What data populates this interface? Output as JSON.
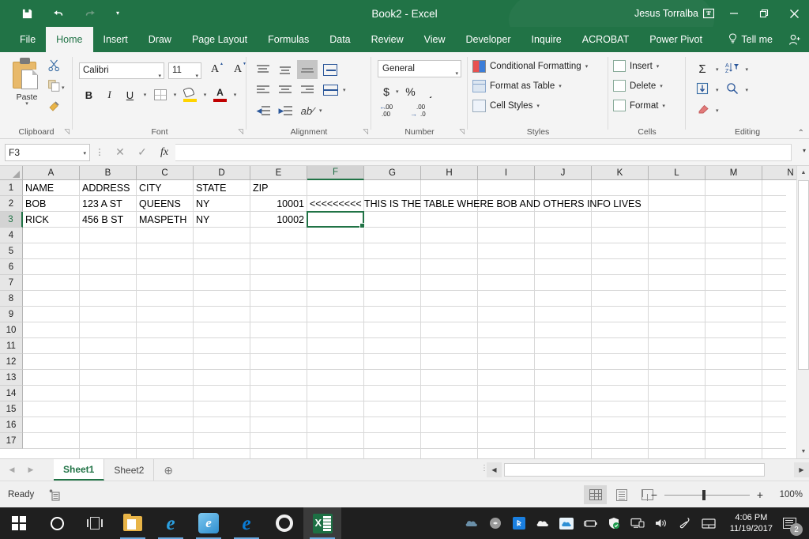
{
  "titlebar": {
    "doc_title": "Book2  -  Excel",
    "account_name": "Jesus Torralba",
    "qat": [
      {
        "name": "save",
        "glyph": "💾"
      },
      {
        "name": "undo",
        "glyph": "↶"
      },
      {
        "name": "redo",
        "glyph": "↷"
      },
      {
        "name": "customize-qat",
        "glyph": "▾"
      }
    ],
    "ribbon_display_options": "❐",
    "minimize": "─",
    "restore": "❐",
    "close": "✕"
  },
  "ribbon_tabs": [
    {
      "label": "File",
      "active": false
    },
    {
      "label": "Home",
      "active": true
    },
    {
      "label": "Insert",
      "active": false
    },
    {
      "label": "Draw",
      "active": false
    },
    {
      "label": "Page Layout",
      "active": false
    },
    {
      "label": "Formulas",
      "active": false
    },
    {
      "label": "Data",
      "active": false
    },
    {
      "label": "Review",
      "active": false
    },
    {
      "label": "View",
      "active": false
    },
    {
      "label": "Developer",
      "active": false
    },
    {
      "label": "Inquire",
      "active": false
    },
    {
      "label": "ACROBAT",
      "active": false
    },
    {
      "label": "Power Pivot",
      "active": false
    }
  ],
  "tell_me": "Tell me",
  "ribbon": {
    "clipboard": {
      "group_label": "Clipboard",
      "paste_label": "Paste",
      "cut_glyph": "✂",
      "copy_name": "copy",
      "format_painter_name": "format-painter"
    },
    "font": {
      "group_label": "Font",
      "font_name": "Calibri",
      "font_size": "11",
      "bold": "B",
      "italic": "I",
      "underline": "U",
      "grow_font": "A",
      "shrink_font": "A",
      "font_color_letter": "A"
    },
    "alignment": {
      "group_label": "Alignment",
      "wrap_text_name": "wrap-text",
      "merge_center_name": "merge-and-center"
    },
    "number": {
      "group_label": "Number",
      "format": "General",
      "currency": "$",
      "percent": "%",
      "comma": "͵",
      "decrease_decimal": ".00",
      "increase_decimal": ".00"
    },
    "styles": {
      "group_label": "Styles",
      "conditional_formatting": "Conditional Formatting",
      "format_as_table": "Format as Table",
      "cell_styles": "Cell Styles"
    },
    "cells": {
      "group_label": "Cells",
      "insert": "Insert",
      "delete": "Delete",
      "format": "Format"
    },
    "editing": {
      "group_label": "Editing",
      "autosum": "Σ",
      "fill": "↓",
      "clear": "◆",
      "sort_filter": "A↕",
      "find_select": "⚲"
    }
  },
  "formula_bar": {
    "name_box": "F3",
    "cancel": "✕",
    "enter": "✓",
    "insert_function": "fx",
    "formula_value": "",
    "formula_placeholder": ""
  },
  "grid": {
    "columns": [
      "A",
      "B",
      "C",
      "D",
      "E",
      "F",
      "G",
      "H",
      "I",
      "J",
      "K",
      "L",
      "M",
      "N"
    ],
    "rows": [
      "1",
      "2",
      "3",
      "4",
      "5",
      "6",
      "7",
      "8",
      "9",
      "10",
      "11",
      "12",
      "13",
      "14",
      "15",
      "16",
      "17"
    ],
    "selected_cell": "F3",
    "selected_column": "F",
    "selected_row": "3",
    "data": [
      {
        "ref": "A1",
        "col": 0,
        "row": 0,
        "value": "NAME",
        "align": "left"
      },
      {
        "ref": "B1",
        "col": 1,
        "row": 0,
        "value": "ADDRESS",
        "align": "left"
      },
      {
        "ref": "C1",
        "col": 2,
        "row": 0,
        "value": "CITY",
        "align": "left"
      },
      {
        "ref": "D1",
        "col": 3,
        "row": 0,
        "value": "STATE",
        "align": "left"
      },
      {
        "ref": "E1",
        "col": 4,
        "row": 0,
        "value": "ZIP",
        "align": "left"
      },
      {
        "ref": "A2",
        "col": 0,
        "row": 1,
        "value": "BOB",
        "align": "left"
      },
      {
        "ref": "B2",
        "col": 1,
        "row": 1,
        "value": "123 A ST",
        "align": "left"
      },
      {
        "ref": "C2",
        "col": 2,
        "row": 1,
        "value": "QUEENS",
        "align": "left"
      },
      {
        "ref": "D2",
        "col": 3,
        "row": 1,
        "value": "NY",
        "align": "left"
      },
      {
        "ref": "E2",
        "col": 4,
        "row": 1,
        "value": "10001",
        "align": "right"
      },
      {
        "ref": "F2",
        "col": 5,
        "row": 1,
        "value": "<<<<<<<<< THIS IS THE TABLE WHERE BOB AND OTHERS INFO LIVES",
        "align": "left",
        "overflow": true
      },
      {
        "ref": "A3",
        "col": 0,
        "row": 2,
        "value": "RICK",
        "align": "left"
      },
      {
        "ref": "B3",
        "col": 1,
        "row": 2,
        "value": "456 B ST",
        "align": "left"
      },
      {
        "ref": "C3",
        "col": 2,
        "row": 2,
        "value": "MASPETH",
        "align": "left"
      },
      {
        "ref": "D3",
        "col": 3,
        "row": 2,
        "value": "NY",
        "align": "left"
      },
      {
        "ref": "E3",
        "col": 4,
        "row": 2,
        "value": "10002",
        "align": "right"
      }
    ]
  },
  "sheet_tabs": {
    "tabs": [
      {
        "label": "Sheet1",
        "active": true
      },
      {
        "label": "Sheet2",
        "active": false
      }
    ],
    "add_sheet": "⊕",
    "prev": "◀",
    "next": "▶"
  },
  "status_bar": {
    "status": "Ready",
    "accessibility_name": "accessibility-checker",
    "zoom_level": "100%",
    "zoom_out": "−",
    "zoom_in": "+",
    "views": [
      {
        "name": "normal-view",
        "active": true
      },
      {
        "name": "page-layout-view",
        "active": false
      },
      {
        "name": "page-break-preview",
        "active": false
      }
    ]
  },
  "taskbar": {
    "start_name": "windows-start",
    "items": [
      {
        "name": "cortana-search-icon"
      },
      {
        "name": "task-view-icon"
      },
      {
        "name": "file-explorer-icon"
      },
      {
        "name": "internet-explorer-icon"
      },
      {
        "name": "app-tile-icon"
      },
      {
        "name": "microsoft-edge-icon"
      },
      {
        "name": "settings-gear-icon"
      },
      {
        "name": "excel-icon"
      }
    ],
    "tray": [
      {
        "name": "onedrive-tray-icon"
      },
      {
        "name": "sync-tray-icon"
      },
      {
        "name": "bluetooth-tray-icon"
      },
      {
        "name": "cloud-tray-icon"
      },
      {
        "name": "cloud-blue-tray-icon"
      },
      {
        "name": "battery-tray-icon"
      },
      {
        "name": "security-shield-tray-icon"
      },
      {
        "name": "network-tray-icon"
      },
      {
        "name": "volume-tray-icon"
      },
      {
        "name": "pen-tray-icon"
      },
      {
        "name": "touchpad-tray-icon"
      }
    ],
    "clock_time": "4:06 PM",
    "clock_date": "11/19/2017",
    "notification_count": "2"
  },
  "colors": {
    "excel_green": "#217346",
    "ribbon_bg": "#f4f4f4",
    "accent_blue": "#2b579a"
  }
}
